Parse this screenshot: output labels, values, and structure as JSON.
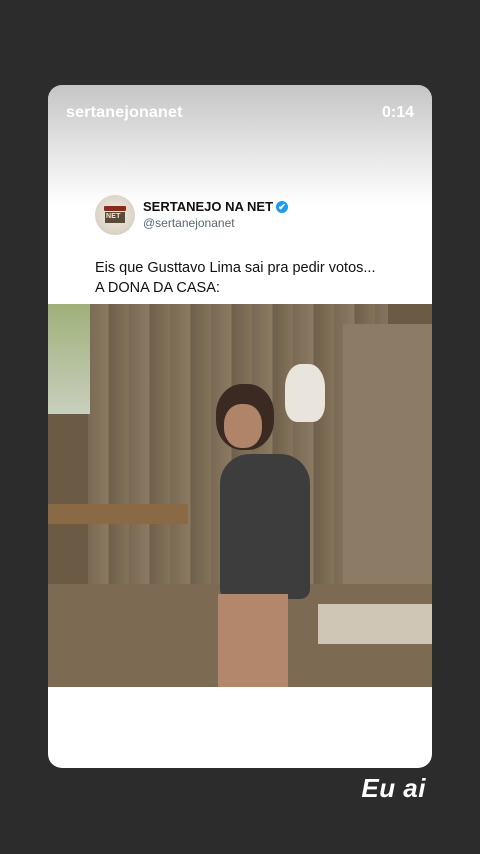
{
  "story": {
    "username": "sertanejonanet",
    "timer": "0:14"
  },
  "tweet": {
    "avatar_text": "NET",
    "display_name": "SERTANEJO NA NET",
    "verified_icon": "✔",
    "handle": "@sertanejonanet",
    "line1": "Eis que Gusttavo Lima sai pra pedir votos...",
    "line2": "A DONA DA CASA:"
  },
  "caption": "Eu ai"
}
